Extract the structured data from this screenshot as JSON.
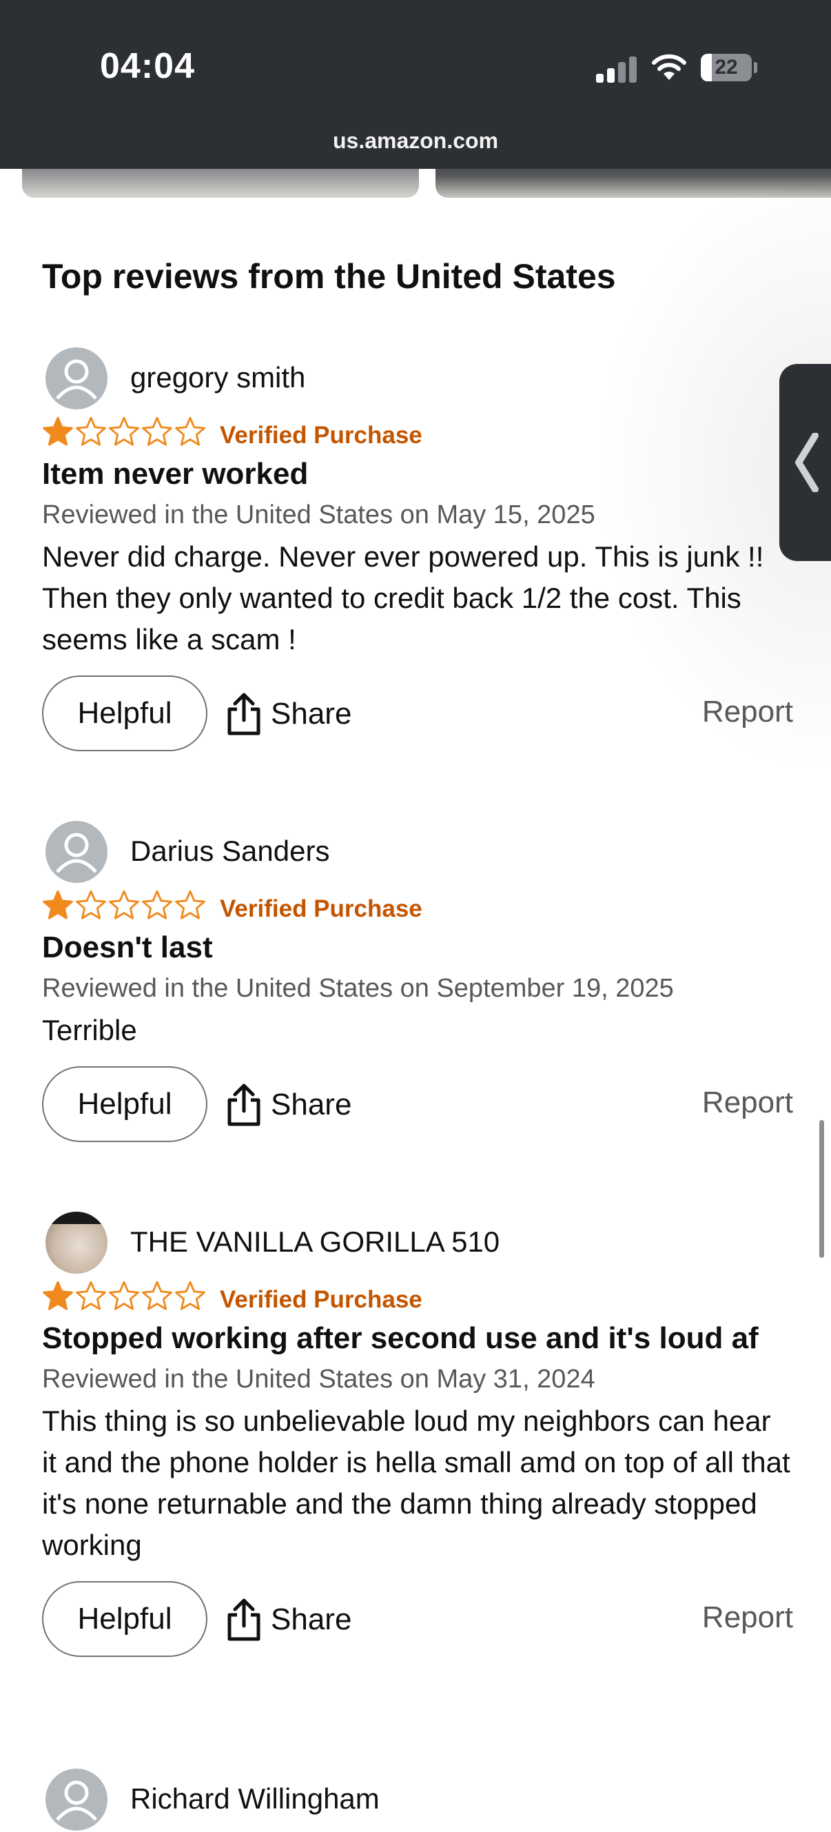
{
  "status_bar": {
    "time": "04:04",
    "battery": "22"
  },
  "browser": {
    "url": "us.amazon.com"
  },
  "reviews_section": {
    "title": "Top reviews from the United States"
  },
  "colors": {
    "star": "#f08a1c",
    "verified": "#c45500",
    "topbar": "#2c2f33"
  },
  "reviews": [
    {
      "reviewer": "gregory smith",
      "rating": 1,
      "max_rating": 5,
      "badge": "Verified Purchase",
      "title": "Item never worked",
      "date": "Reviewed in the United States on May 15, 2025",
      "body": "Never did charge. Never ever powered up. This is junk !! Then they only wanted to credit back 1/2 the cost. This seems like a scam !",
      "helpful_label": "Helpful",
      "share_label": "Share",
      "report_label": "Report",
      "avatar": "default-avatar-icon"
    },
    {
      "reviewer": "Darius Sanders",
      "rating": 1,
      "max_rating": 5,
      "badge": "Verified Purchase",
      "title": "Doesn't last",
      "date": "Reviewed in the United States on September 19, 2025",
      "body": "Terrible",
      "helpful_label": "Helpful",
      "share_label": "Share",
      "report_label": "Report",
      "avatar": "default-avatar-icon"
    },
    {
      "reviewer": "THE VANILLA GORILLA 510",
      "rating": 1,
      "max_rating": 5,
      "badge": "Verified Purchase",
      "title": "Stopped working after second use and it's loud af",
      "date": "Reviewed in the United States on May 31, 2024",
      "body": "This thing is so unbelievable loud my neighbors can hear it and the phone holder is hella small amd on top of all that it's none returnable and the damn thing already stopped working",
      "helpful_label": "Helpful",
      "share_label": "Share",
      "report_label": "Report",
      "avatar": "photo-avatar"
    },
    {
      "reviewer": "Richard Willingham",
      "avatar": "default-avatar-icon"
    }
  ]
}
